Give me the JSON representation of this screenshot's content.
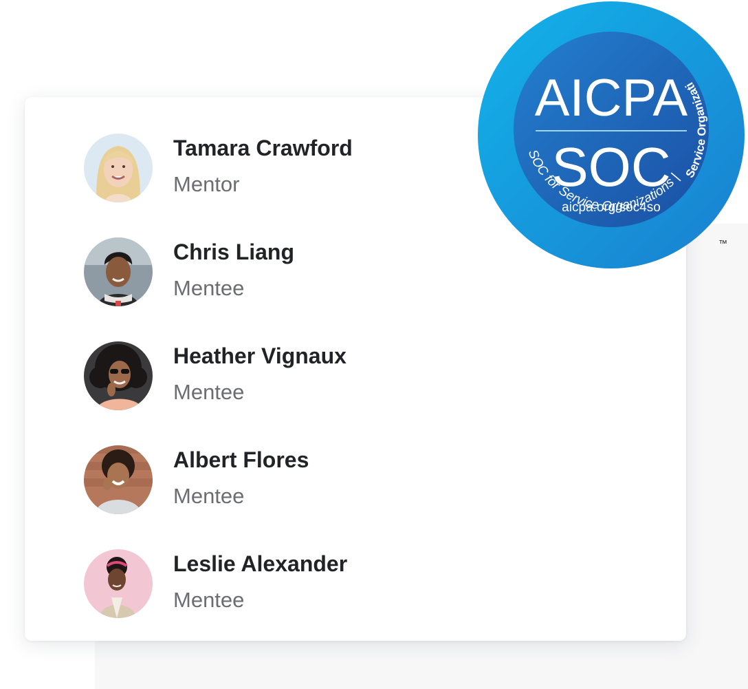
{
  "people": [
    {
      "name": "Tamara Crawford",
      "role": "Mentor"
    },
    {
      "name": "Chris Liang",
      "role": "Mentee"
    },
    {
      "name": "Heather Vignaux",
      "role": "Mentee"
    },
    {
      "name": "Albert Flores",
      "role": "Mentee"
    },
    {
      "name": "Leslie Alexander",
      "role": "Mentee"
    }
  ],
  "badge": {
    "line1": "AICPA",
    "line2": "SOC",
    "url": "aicpa.org/soc4so",
    "ring_text_bottom": "SOC for Service Organizations",
    "ring_text_side": "Service Organizations",
    "trademark": "™"
  },
  "colors": {
    "badge_outer": "#1aa6e0",
    "badge_inner": "#1e6fc0",
    "name_text": "#222326",
    "role_text": "#6c6d72"
  }
}
